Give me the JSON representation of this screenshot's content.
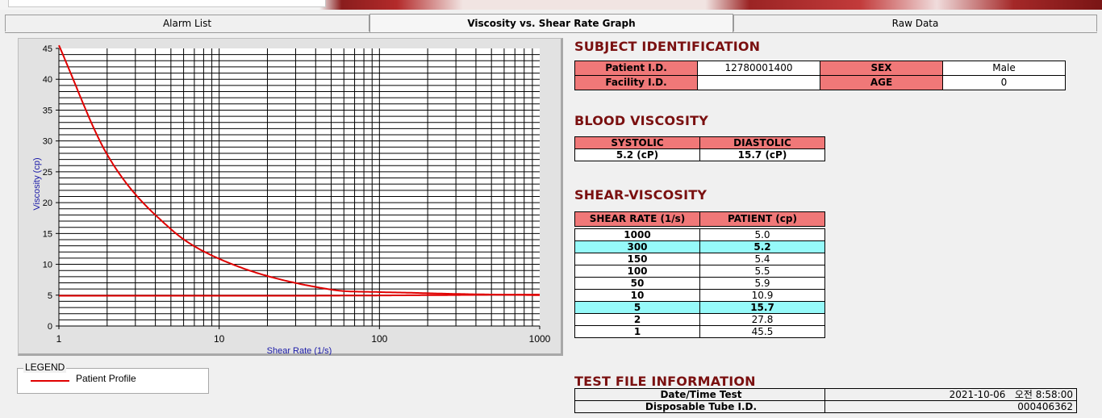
{
  "tabs": [
    {
      "label": "Alarm List"
    },
    {
      "label": "Viscosity vs. Shear Rate Graph"
    },
    {
      "label": "Raw Data"
    }
  ],
  "chart_data": {
    "type": "line",
    "xlabel": "Shear Rate (1/s)",
    "ylabel": "Viscosity (cp)",
    "x_scale": "log",
    "xlim": [
      1,
      1000
    ],
    "ylim": [
      0,
      45
    ],
    "x_ticks": [
      "1",
      "10",
      "100",
      "1000"
    ],
    "y_ticks": [
      "0",
      "5",
      "10",
      "15",
      "20",
      "25",
      "30",
      "35",
      "40",
      "45"
    ],
    "grid": true,
    "series": [
      {
        "name": "Patient Profile",
        "color": "#e00000",
        "x": [
          1,
          2,
          5,
          10,
          50,
          100,
          150,
          300,
          1000
        ],
        "y": [
          45.5,
          27.8,
          15.7,
          10.9,
          5.9,
          5.5,
          5.4,
          5.2,
          5.0
        ]
      },
      {
        "color": "#e00000",
        "x": [
          1,
          20,
          1000
        ],
        "y": [
          4.9,
          4.9,
          5.1
        ]
      }
    ]
  },
  "legend": {
    "title": "LEGEND",
    "items": [
      {
        "label": "Patient Profile",
        "color": "#e00000"
      }
    ]
  },
  "subject": {
    "title": "SUBJECT IDENTIFICATION",
    "patient_id_label": "Patient I.D.",
    "patient_id": "12780001400",
    "sex_label": "SEX",
    "sex": "Male",
    "facility_id_label": "Facility I.D.",
    "facility_id": "",
    "age_label": "AGE",
    "age": "0"
  },
  "blood_viscosity": {
    "title": "BLOOD VISCOSITY",
    "systolic_label": "SYSTOLIC",
    "diastolic_label": "DIASTOLIC",
    "systolic": "5.2 (cP)",
    "diastolic": "15.7 (cP)"
  },
  "shear_viscosity": {
    "title": "SHEAR-VISCOSITY",
    "col_rate": "SHEAR RATE (1/s)",
    "col_patient": "PATIENT (cp)",
    "rows": [
      {
        "rate": "1000",
        "patient": "5.0"
      },
      {
        "rate": "300",
        "patient": "5.2"
      },
      {
        "rate": "150",
        "patient": "5.4"
      },
      {
        "rate": "100",
        "patient": "5.5"
      },
      {
        "rate": "50",
        "patient": "5.9"
      },
      {
        "rate": "10",
        "patient": "10.9"
      },
      {
        "rate": "5",
        "patient": "15.7"
      },
      {
        "rate": "2",
        "patient": "27.8"
      },
      {
        "rate": "1",
        "patient": "45.5"
      }
    ]
  },
  "test_file": {
    "title": "TEST FILE INFORMATION",
    "datetime_label": "Date/Time Test",
    "datetime": "2021-10-06   오전 8:58:00",
    "tube_label": "Disposable Tube I.D.",
    "tube_id": "000406362"
  }
}
